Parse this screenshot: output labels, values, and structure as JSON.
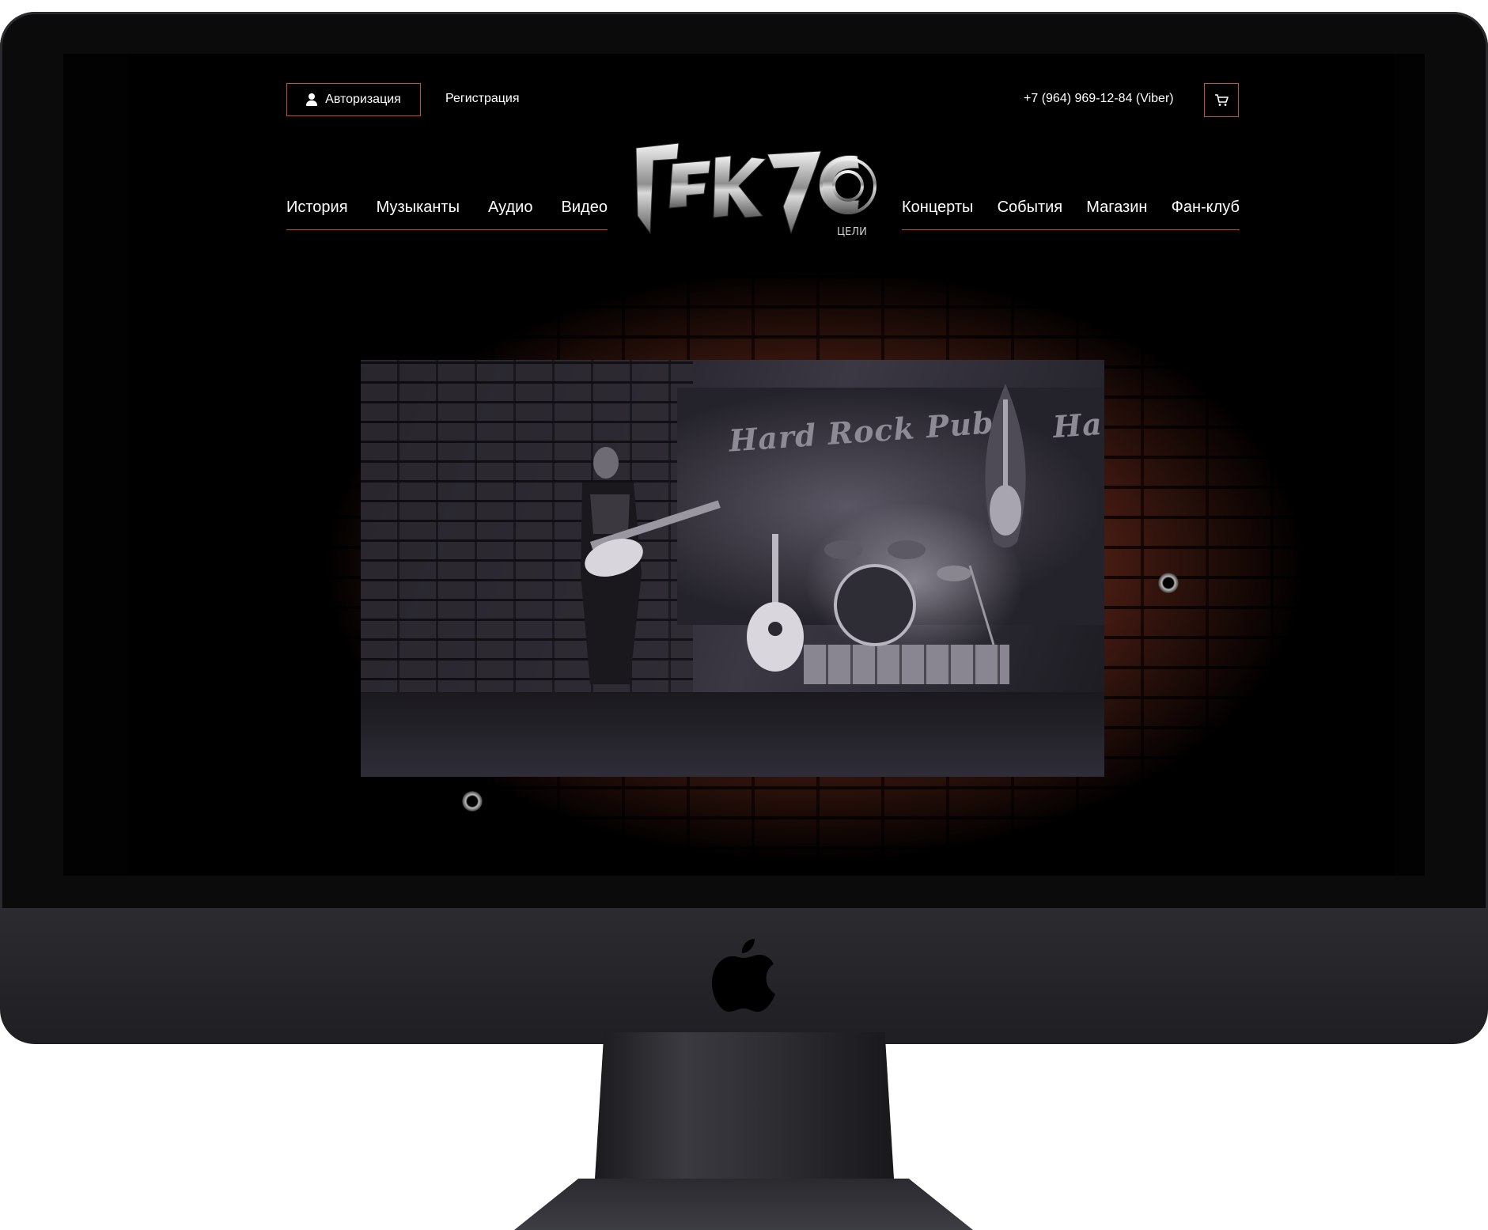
{
  "header": {
    "auth_label": "Авторизация",
    "register_label": "Регистрация",
    "phone": "+7 (964) 969-12-84 (Viber)"
  },
  "nav": {
    "left": [
      "История",
      "Музыканты",
      "Аудио",
      "Видео"
    ],
    "right": [
      "Концерты",
      "События",
      "Магазин",
      "Фан-клуб"
    ]
  },
  "logo": {
    "text": "ГЕКУЗС",
    "sub": "ЦЕЛИ"
  },
  "hero": {
    "sign": "Hard Rock Pub",
    "sign_partial": "Ha"
  },
  "colors": {
    "accent": "#c2532b",
    "background": "#000000",
    "text": "#ffffff"
  },
  "icons": [
    "user-icon",
    "cart-icon",
    "apple-logo-icon"
  ]
}
